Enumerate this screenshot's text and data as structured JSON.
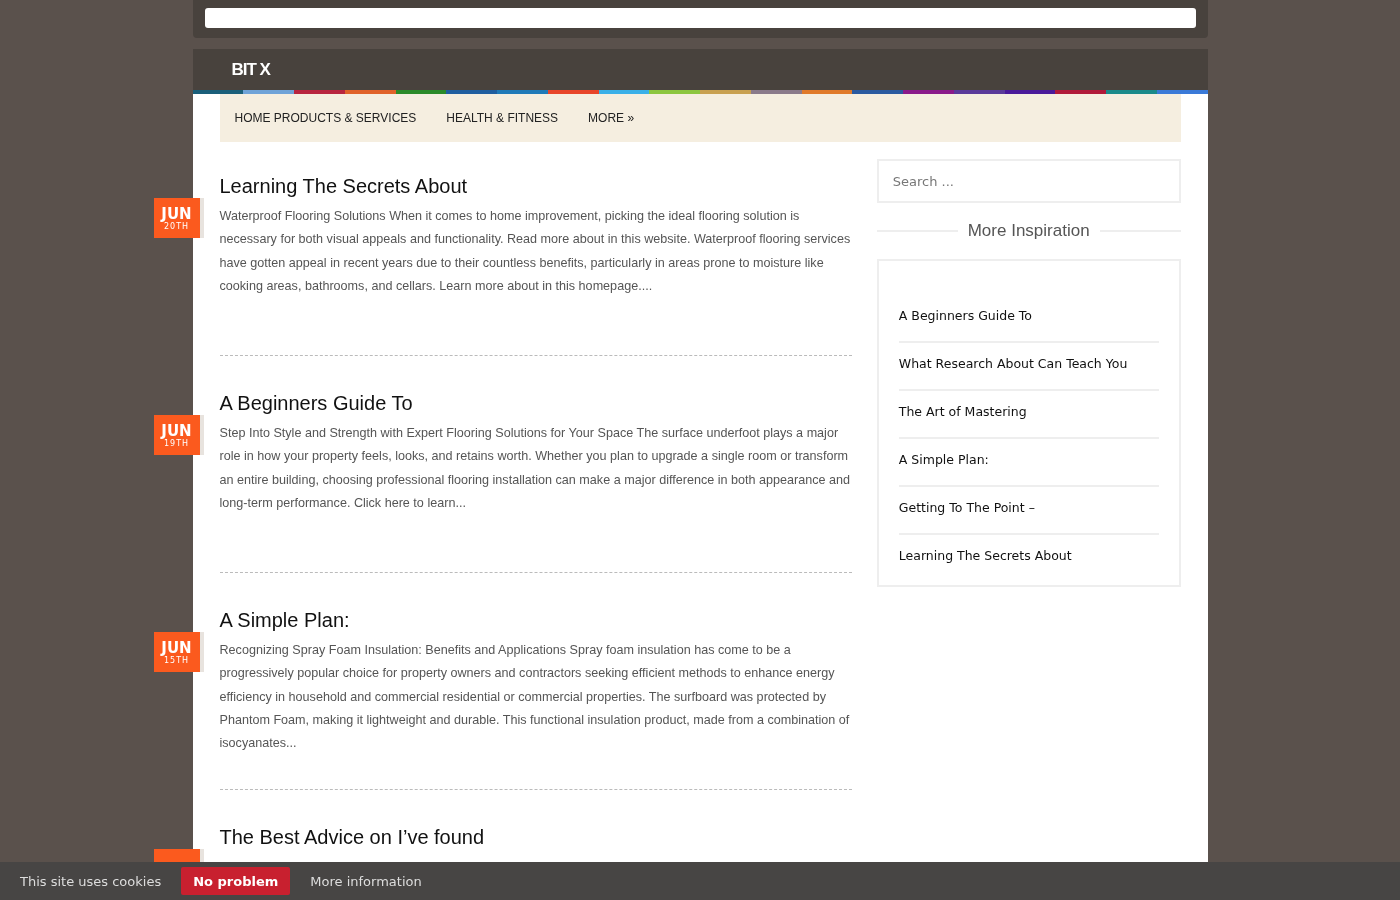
{
  "site": {
    "title": "BIT X"
  },
  "nav": [
    {
      "label": "HOME PRODUCTS & SERVICES"
    },
    {
      "label": "HEALTH & FITNESS"
    },
    {
      "label": "MORE »"
    }
  ],
  "posts": [
    {
      "title": "Learning The Secrets About",
      "month": "JUN",
      "day": "20TH",
      "excerpt": "Waterproof Flooring Solutions When it comes to home improvement, picking the ideal flooring solution is necessary for both visual appeals and functionality. Read more about in this website. Waterproof flooring services have gotten appeal in recent years due to their countless benefits, particularly in areas prone to moisture like cooking areas, bathrooms, and cellars. Learn more about in this homepage...."
    },
    {
      "title": "A Beginners Guide To",
      "month": "JUN",
      "day": "19TH",
      "excerpt": "Step Into Style and Strength with Expert Flooring Solutions for Your Space The surface underfoot plays a major role in how your property feels, looks, and retains worth. Whether you plan to upgrade a single room or transform an entire building, choosing professional flooring installation can make a major difference in both appearance and long-term performance. Click here to learn..."
    },
    {
      "title": "A Simple Plan:",
      "month": "JUN",
      "day": "15TH",
      "excerpt": "Recognizing Spray Foam Insulation: Benefits and Applications Spray foam insulation has come to be a progressively popular choice for property owners and contractors seeking efficient methods to enhance energy efficiency in household and commercial residential or commercial properties. The surfboard was protected by Phantom Foam, making it lightweight and durable. This functional insulation product, made from a combination of isocyanates..."
    },
    {
      "title": "The Best Advice on I’ve found"
    }
  ],
  "sidebar": {
    "search": {
      "placeholder": "Search ..."
    },
    "heading": "More Inspiration",
    "links": [
      {
        "label": "A Beginners Guide To"
      },
      {
        "label": "What Research About Can Teach You"
      },
      {
        "label": "The Art of Mastering"
      },
      {
        "label": "A Simple Plan:"
      },
      {
        "label": "Getting To The Point –"
      },
      {
        "label": "Learning The Secrets About"
      }
    ]
  },
  "cookie_bar": {
    "text": "This site uses cookies",
    "accept": "No problem",
    "more": "More information"
  }
}
